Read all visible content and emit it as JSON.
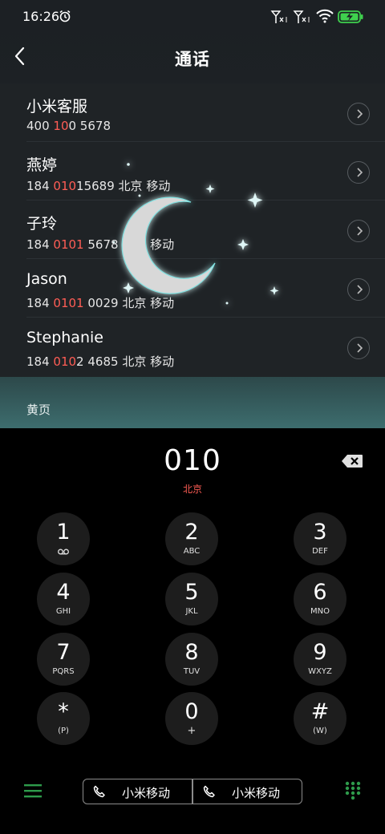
{
  "status_bar": {
    "time": "16:26",
    "icons": [
      "alarm-icon",
      "signal-no-service-icon",
      "signal-no-service-icon",
      "wifi-icon",
      "battery-charging-icon"
    ]
  },
  "header": {
    "title": "通话"
  },
  "contacts": [
    {
      "name": "小米客服",
      "num_a": "400 ",
      "num_hl": "10",
      "num_b": "0 5678",
      "num_c": ""
    },
    {
      "name": "燕婷",
      "num_a": "184 ",
      "num_hl": "010",
      "num_b": "15689",
      "num_c": "北京 移动"
    },
    {
      "name": "子玲",
      "num_a": "184 ",
      "num_hl": "0101",
      "num_b": " 5678",
      "num_c": "北京 移动"
    },
    {
      "name": "Jason",
      "num_a": "184 ",
      "num_hl": "0101",
      "num_b": " 0029",
      "num_c": "北京 移动"
    },
    {
      "name": "Stephanie",
      "num_a": "184 ",
      "num_hl": "010",
      "num_b": "2 4685",
      "num_c": "北京 移动"
    }
  ],
  "section": {
    "yellow_pages": "黄页"
  },
  "dialer": {
    "typed": "010",
    "location": "北京",
    "keys": [
      {
        "digit": "1",
        "letters": ""
      },
      {
        "digit": "2",
        "letters": "ABC"
      },
      {
        "digit": "3",
        "letters": "DEF"
      },
      {
        "digit": "4",
        "letters": "GHI"
      },
      {
        "digit": "5",
        "letters": "JKL"
      },
      {
        "digit": "6",
        "letters": "MNO"
      },
      {
        "digit": "7",
        "letters": "PQRS"
      },
      {
        "digit": "8",
        "letters": "TUV"
      },
      {
        "digit": "9",
        "letters": "WXYZ"
      },
      {
        "digit": "*",
        "letters": "(P)"
      },
      {
        "digit": "0",
        "letters": "+"
      },
      {
        "digit": "#",
        "letters": "(W)"
      }
    ]
  },
  "bottom": {
    "sim1_label": "小米移动",
    "sim2_label": "小米移动"
  },
  "colors": {
    "accent_red": "#ff5d55",
    "accent_green": "#2e9b4b",
    "key_bg": "#1d1d1d"
  }
}
